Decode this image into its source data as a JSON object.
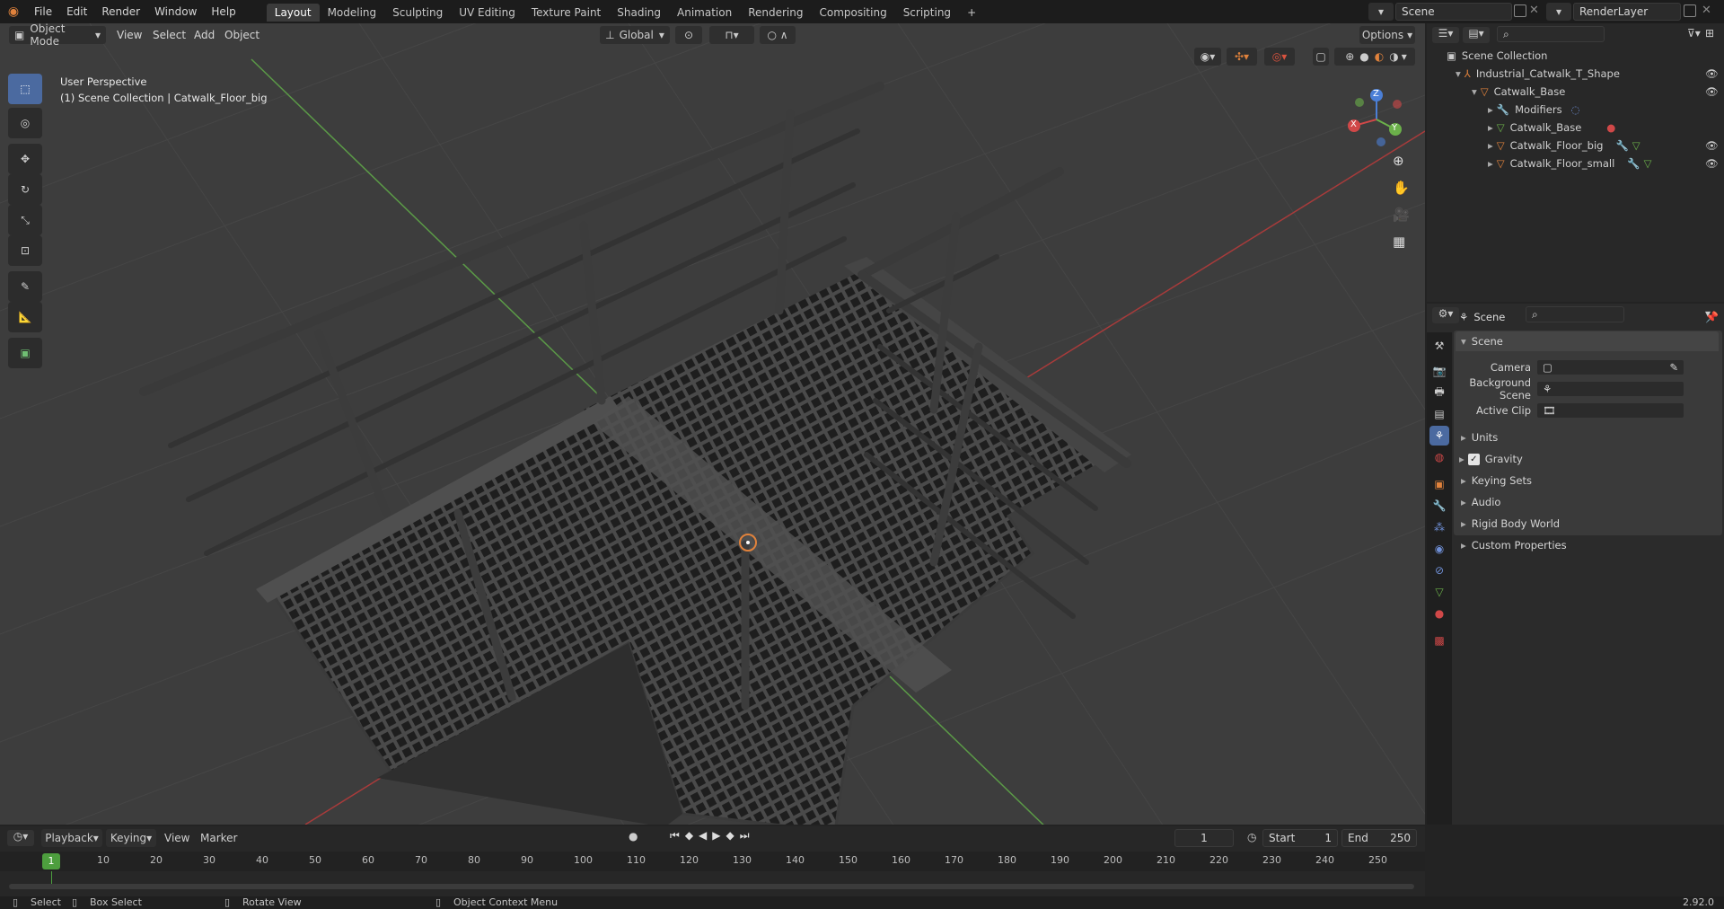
{
  "topbar": {
    "menus": [
      "File",
      "Edit",
      "Render",
      "Window",
      "Help"
    ],
    "workspaces": [
      "Layout",
      "Modeling",
      "Sculpting",
      "UV Editing",
      "Texture Paint",
      "Shading",
      "Animation",
      "Rendering",
      "Compositing",
      "Scripting"
    ],
    "add_tab": "+",
    "scene_name": "Scene",
    "view_layer": "RenderLayer"
  },
  "viewport_header": {
    "mode": "Object Mode",
    "menus": [
      "View",
      "Select",
      "Add",
      "Object"
    ],
    "orientation": "Global",
    "options_label": "Options"
  },
  "viewport": {
    "perspective": "User Perspective",
    "collection_info": "(1) Scene Collection | Catwalk_Floor_big",
    "gizmo": {
      "x": "X",
      "y": "Y",
      "z": "Z"
    }
  },
  "outliner": {
    "root": "Scene Collection",
    "items": [
      {
        "label": "Industrial_Catwalk_T_Shape",
        "icon": "empty-icon",
        "indent": 1
      },
      {
        "label": "Catwalk_Base",
        "icon": "mesh-object-icon",
        "indent": 2
      },
      {
        "label": "Modifiers",
        "icon": "wrench-icon",
        "indent": 3
      },
      {
        "label": "Catwalk_Base",
        "icon": "mesh-data-icon",
        "indent": 3
      },
      {
        "label": "Catwalk_Floor_big",
        "icon": "mesh-object-icon",
        "indent": 3
      },
      {
        "label": "Catwalk_Floor_small",
        "icon": "mesh-object-icon",
        "indent": 3
      }
    ]
  },
  "properties": {
    "context": "Scene",
    "panel_title": "Scene",
    "fields": [
      {
        "label": "Camera",
        "value": ""
      },
      {
        "label": "Background Scene",
        "value": ""
      },
      {
        "label": "Active Clip",
        "value": ""
      }
    ],
    "subpanels": [
      "Units",
      "Gravity",
      "Keying Sets",
      "Audio",
      "Rigid Body World",
      "Custom Properties"
    ],
    "gravity_checked": true
  },
  "timeline": {
    "menus": [
      "Playback",
      "Keying",
      "View",
      "Marker"
    ],
    "current_frame": "1",
    "start_label": "Start",
    "start": "1",
    "end_label": "End",
    "end": "250",
    "ticks": [
      "10",
      "20",
      "30",
      "40",
      "50",
      "60",
      "70",
      "80",
      "90",
      "100",
      "110",
      "120",
      "130",
      "140",
      "150",
      "160",
      "170",
      "180",
      "190",
      "200",
      "210",
      "220",
      "230",
      "240",
      "250"
    ],
    "playhead_label": "1"
  },
  "statusbar": {
    "select": "Select",
    "box_select": "Box Select",
    "rotate_view": "Rotate View",
    "context_menu": "Object Context Menu",
    "version": "2.92.0"
  },
  "colors": {
    "accent": "#4b6aa0",
    "orange": "#e0823c",
    "axis_x": "#a83b3b",
    "axis_y": "#5b9a47"
  }
}
